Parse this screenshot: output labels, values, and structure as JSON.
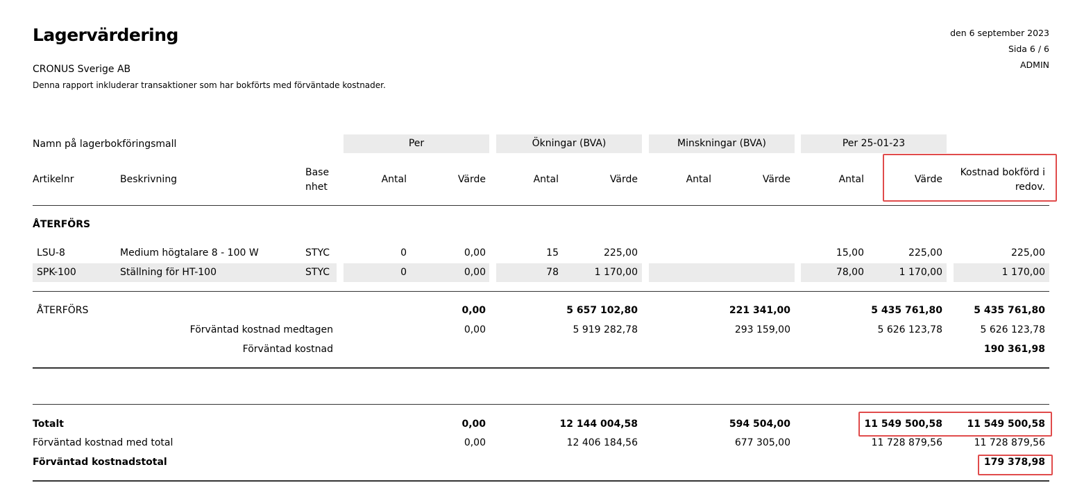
{
  "report": {
    "title": "Lagervärdering",
    "company": "CRONUS Sverige AB",
    "note": "Denna rapport inkluderar transaktioner som har bokförts med förväntade kostnader.",
    "date": "den 6 september 2023",
    "page": "Sida 6 / 6",
    "user": "ADMIN"
  },
  "headers": {
    "group_label": "Namn på lagerbokföringsmall",
    "groups": [
      "Per",
      "Ökningar (BVA)",
      "Minskningar (BVA)",
      "Per 25-01-23"
    ],
    "artikelnr": "Artikelnr",
    "beskrivning": "Beskrivning",
    "base_line1": "Base",
    "base_line2": "nhet",
    "antal": "Antal",
    "varde": "Värde",
    "kostnad_line1": "Kostnad bokförd i",
    "kostnad_line2": "redov."
  },
  "section": "ÅTERFÖRS",
  "items": [
    {
      "nr": "LSU-8",
      "desc": "Medium högtalare 8 - 100 W",
      "unit": "STYC",
      "per_antal": "0",
      "per_varde": "0,00",
      "okn_antal": "15",
      "okn_varde": "225,00",
      "min_antal": "",
      "min_varde": "",
      "end_antal": "15,00",
      "end_varde": "225,00",
      "kostnad": "225,00"
    },
    {
      "nr": "SPK-100",
      "desc": "Ställning för HT-100",
      "unit": "STYC",
      "per_antal": "0",
      "per_varde": "0,00",
      "okn_antal": "78",
      "okn_varde": "1 170,00",
      "min_antal": "",
      "min_varde": "",
      "end_antal": "78,00",
      "end_varde": "1 170,00",
      "kostnad": "1 170,00"
    }
  ],
  "subtotal": {
    "label": "ÅTERFÖRS",
    "per_varde": "0,00",
    "okn_varde": "5 657 102,80",
    "min_varde": "221 341,00",
    "end_varde": "5 435 761,80",
    "kostnad": "5 435 761,80",
    "expected_incl_label": "Förväntad kostnad medtagen",
    "expected_incl": {
      "per": "0,00",
      "okn": "5 919 282,78",
      "min": "293 159,00",
      "end": "5 626 123,78",
      "kostnad": "5 626 123,78"
    },
    "expected_label": "Förväntad kostnad",
    "expected_kostnad": "190 361,98"
  },
  "total": {
    "label": "Totalt",
    "per_varde": "0,00",
    "okn_varde": "12 144 004,58",
    "min_varde": "594 504,00",
    "end_varde": "11 549 500,58",
    "kostnad": "11 549 500,58",
    "expected_label": "Förväntad kostnad med total",
    "expected": {
      "per": "0,00",
      "okn": "12 406 184,56",
      "min": "677 305,00",
      "end": "11 728 879,56",
      "kostnad": "11 728 879,56"
    },
    "expected_total_label": "Förväntad kostnadstotal",
    "expected_total": "179 378,98"
  },
  "colors": {
    "highlight_border": "#e04b4b",
    "shade": "#ebebeb"
  }
}
